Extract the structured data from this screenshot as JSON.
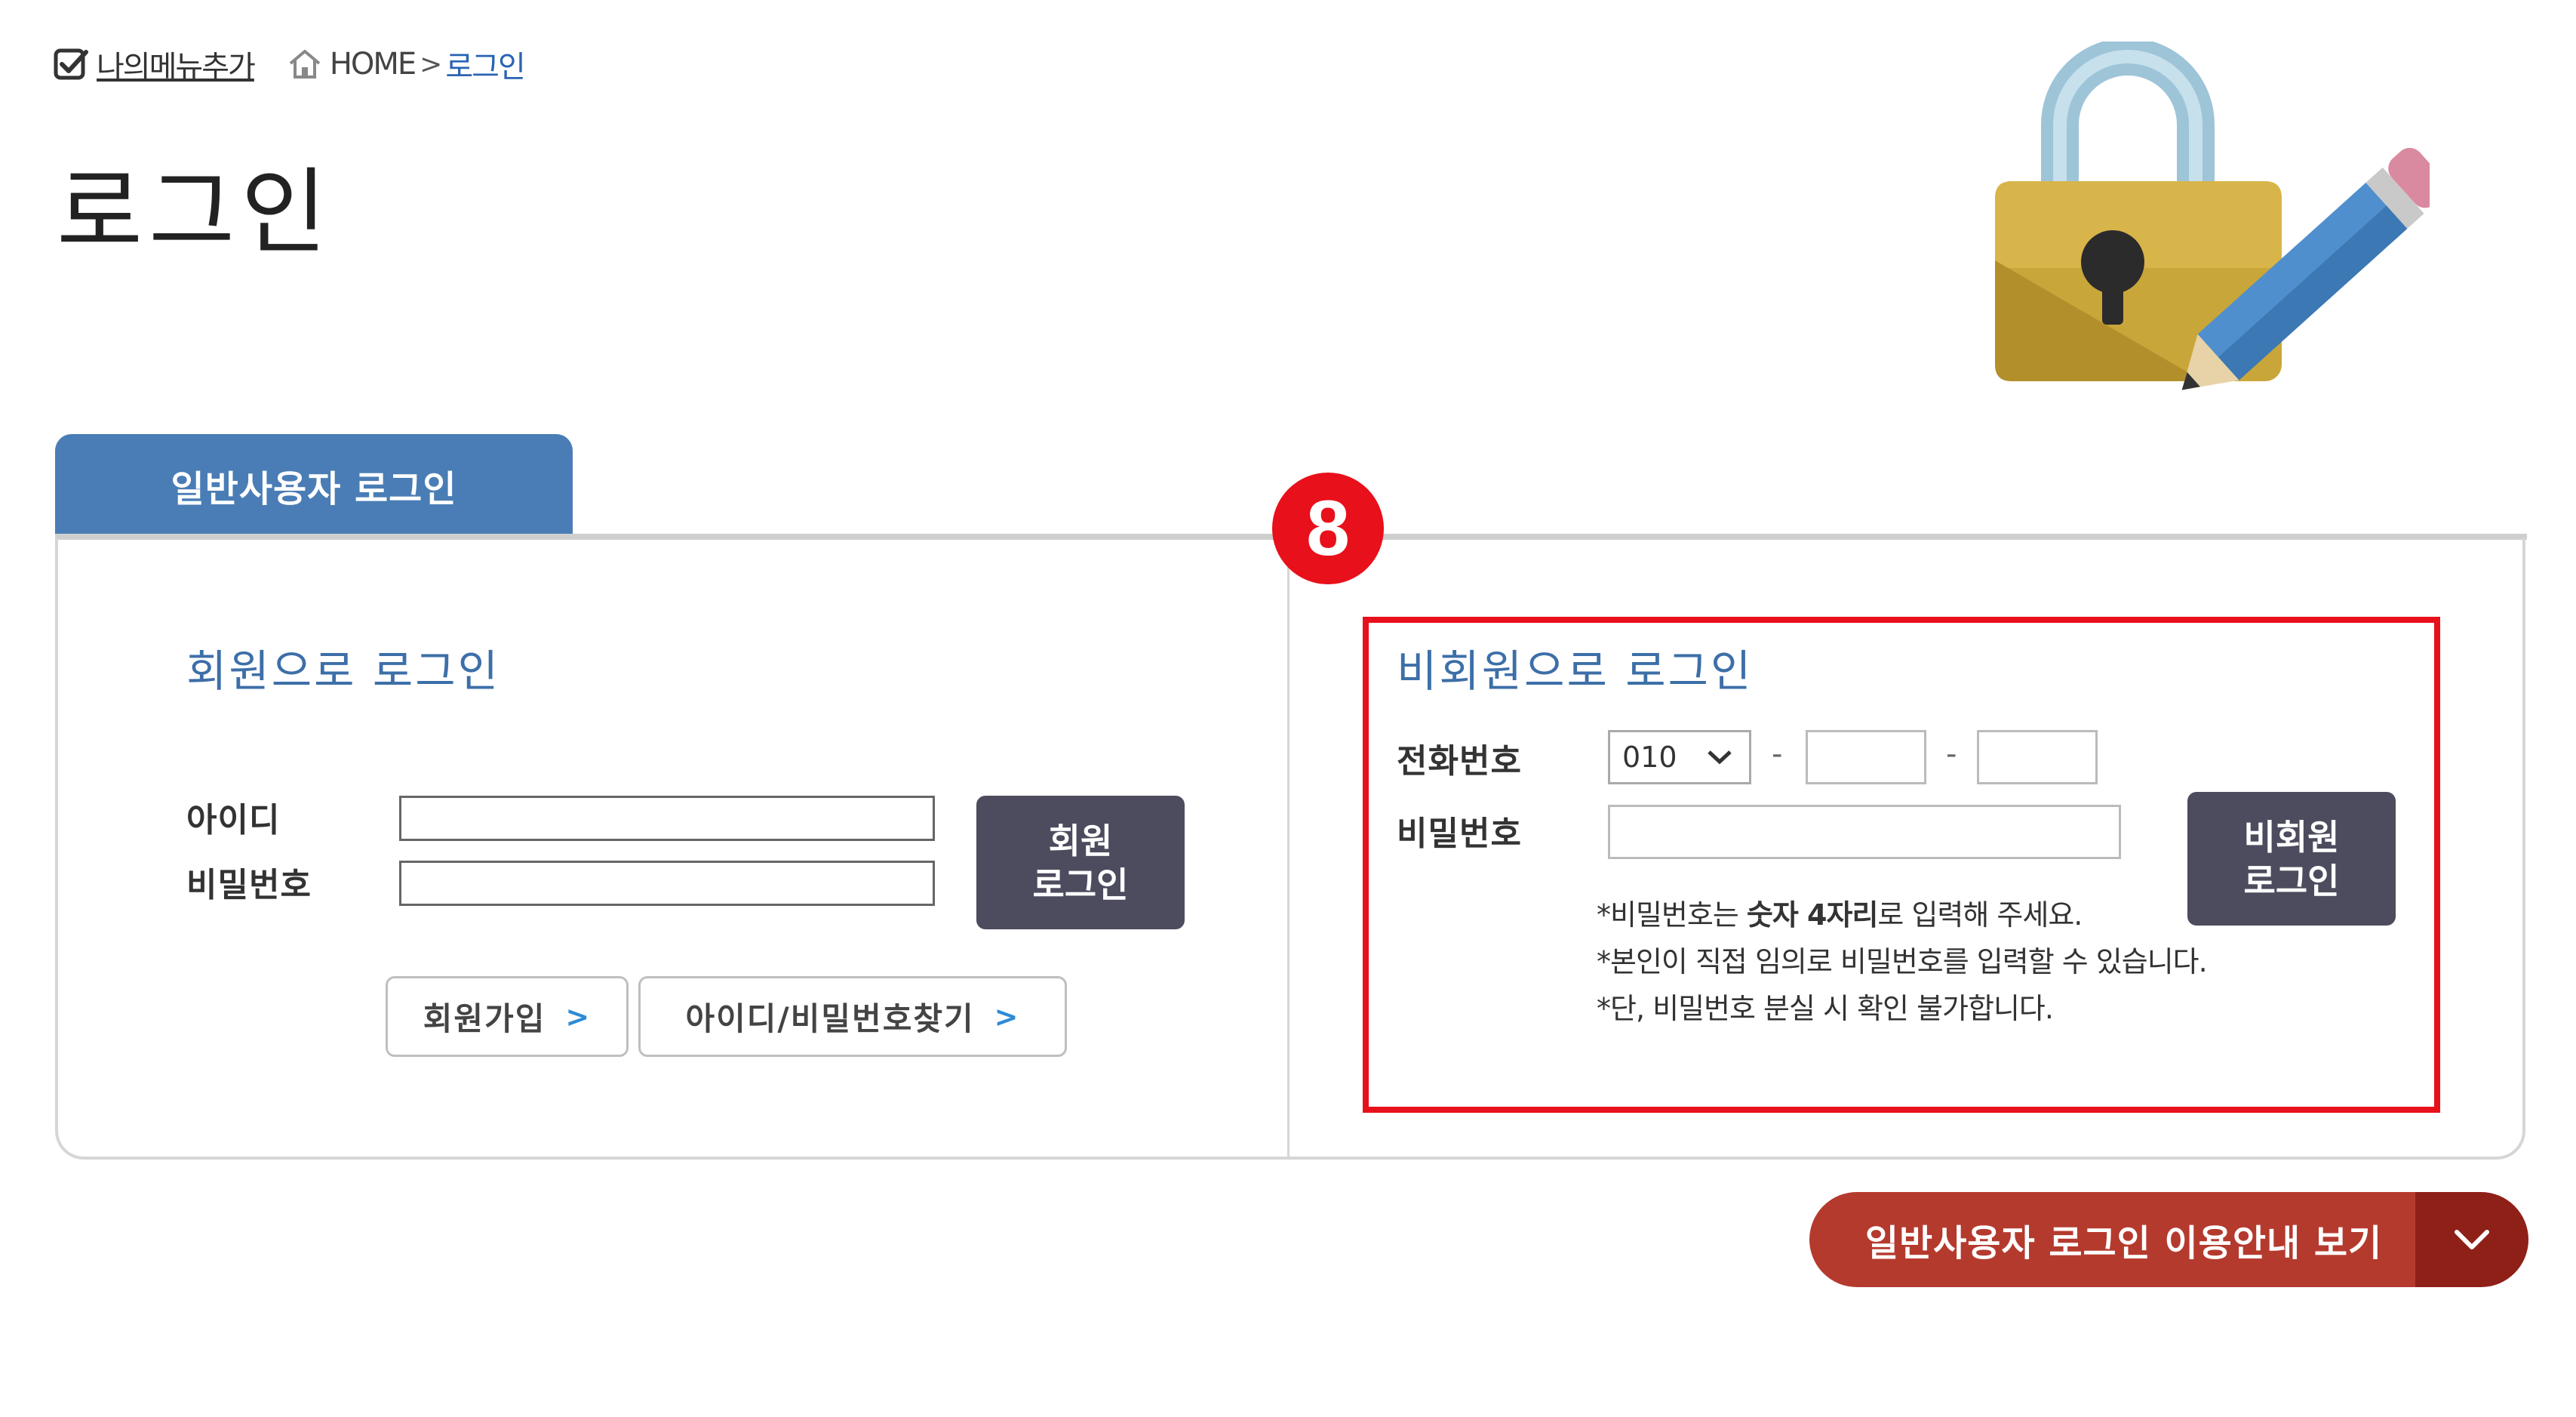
{
  "header": {
    "my_menu_add": "나의메뉴추가",
    "breadcrumb": {
      "home": "HOME",
      "separator": ">",
      "current": "로그인"
    }
  },
  "page_title": "로그인",
  "tab": {
    "label": "일반사용자 로그인"
  },
  "member_login": {
    "title": "회원으로 로그인",
    "id_label": "아이디",
    "password_label": "비밀번호",
    "id_value": "",
    "password_value": "",
    "login_button": {
      "line1": "회원",
      "line2": "로그인"
    },
    "signup_button": "회원가입",
    "find_button": "아이디/비밀번호찾기",
    "chevron": ">"
  },
  "guest_login": {
    "title": "비회원으로 로그인",
    "phone_label": "전화번호",
    "phone_prefix_selected": "010",
    "phone_dash": "-",
    "phone_mid": "",
    "phone_last": "",
    "password_label": "비밀번호",
    "password_value": "",
    "login_button": {
      "line1": "비회원",
      "line2": "로그인"
    },
    "notes": {
      "note1_pre": "*비밀번호는 ",
      "note1_bold": "숫자 4자리",
      "note1_post": "로 입력해 주세요.",
      "note2": "*본인이 직접 임의로 비밀번호를 입력할 수 있습니다.",
      "note3": "*단, 비밀번호 분실 시 확인 불가합니다."
    }
  },
  "annotation_badge": "8",
  "guide_button": {
    "label": "일반사용자 로그인 이용안내 보기"
  },
  "colors": {
    "tab_blue": "#4a7db5",
    "section_title_blue": "#3d6fa8",
    "dark_button": "#4c4c5e",
    "highlight_red": "#e8101a",
    "guide_red": "#b53a2e",
    "guide_dark_red": "#8e2018"
  },
  "icons": {
    "my_menu": "check-box-icon",
    "home": "home-icon",
    "illustration": "lock-pencil-illustration",
    "select": "chevron-down-icon",
    "guide_toggle": "chevron-down-icon"
  }
}
